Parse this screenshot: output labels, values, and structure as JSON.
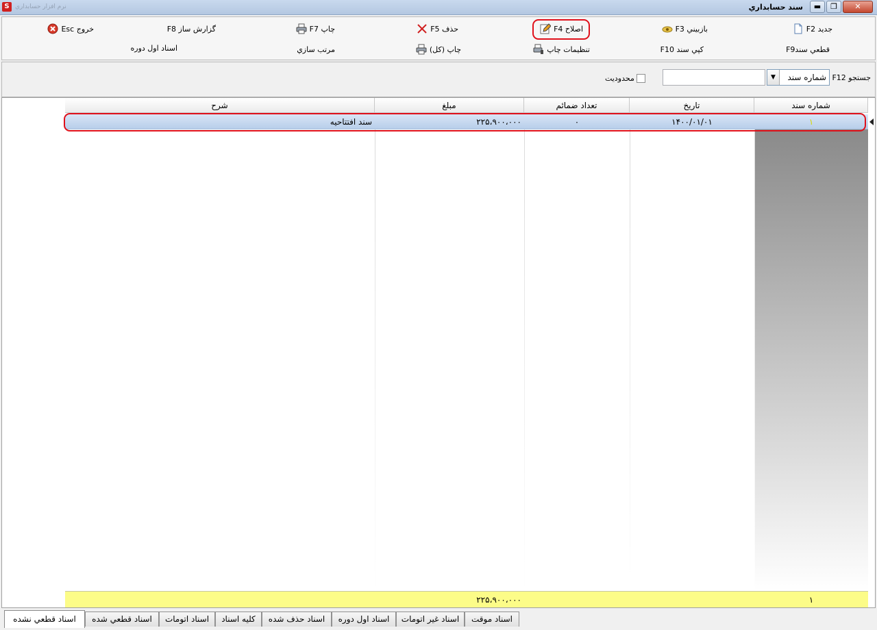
{
  "window": {
    "title": "سند حسابداري",
    "app_name": "نرم افزار حسابداري",
    "close_label": "✕",
    "restore_label": "❐",
    "min_label": "▬"
  },
  "toolbar": {
    "new": "جديد  F2",
    "review": "بازبيني F3",
    "edit": "اصلاح F4",
    "delete": "حذف F5",
    "print": "چاپ  F7",
    "report_builder": "گزارش ساز F8",
    "exit": "خروج Esc",
    "finalize": "قطعي سندF9",
    "copy": "کپي سند F10",
    "print_settings": "تنظيمات چاپ",
    "print_all": "چاپ (کل)",
    "sort": "مرتب سازي",
    "opening_docs": "اسناد اول دوره"
  },
  "search": {
    "label": "جستجو F12",
    "field": "شماره سند",
    "value": "",
    "limit_label": "محدوديت"
  },
  "grid": {
    "columns": [
      "شماره سند",
      "تاريخ",
      "تعداد ضمائم",
      "مبلغ",
      "شرح"
    ],
    "rows": [
      {
        "number": "۱",
        "date": "۱۴۰۰/۰۱/۰۱",
        "attachments": "۰",
        "amount": "۲۲۵،۹۰۰،۰۰۰",
        "description": "سند افتتاحيه"
      }
    ],
    "footer": {
      "count": "۱",
      "amount_total": "۲۲۵،۹۰۰،۰۰۰"
    }
  },
  "tabs": [
    "اسناد موقت",
    "اسناد غير اتومات",
    "اسناد اول دوره",
    "اسناد حذف شده",
    "کليه اسناد",
    "اسناد اتومات",
    "اسناد قطعي شده",
    "اسناد قطعي نشده"
  ],
  "active_tab": "اسناد قطعي نشده",
  "colors": {
    "highlight": "#e0101a",
    "footer": "#fcfc88",
    "row_selected": "#c8daf0"
  }
}
